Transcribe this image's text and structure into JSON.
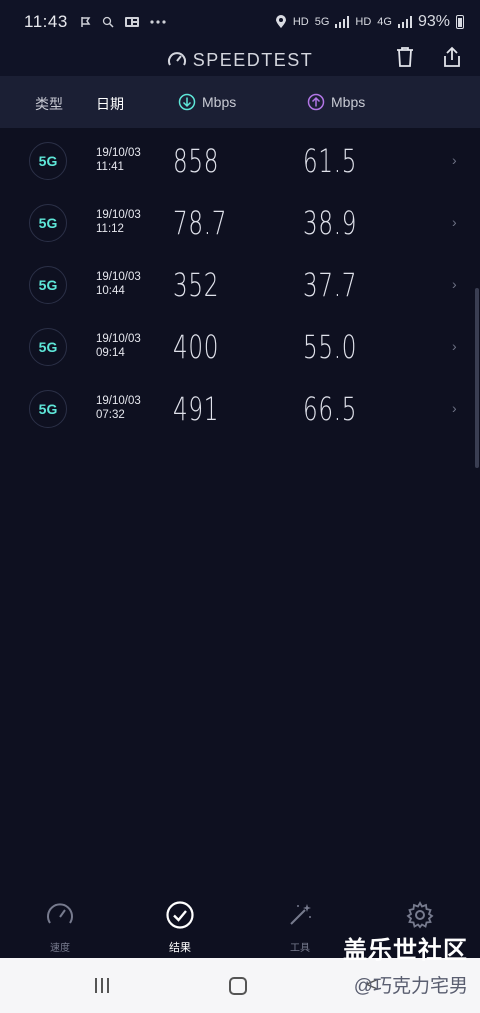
{
  "status_bar": {
    "time": "11:43",
    "left_icons": [
      "flag-icon",
      "search-icon",
      "news-icon",
      "more-icon"
    ],
    "hd1": "HD",
    "network": "5G",
    "hd2": "HD",
    "network2": "4G",
    "battery": "93%"
  },
  "app_bar": {
    "title": "SPEEDTEST"
  },
  "table_header": {
    "type": "类型",
    "date": "日期",
    "download_unit": "Mbps",
    "upload_unit": "Mbps"
  },
  "results": [
    {
      "type": "5G",
      "date": "19/10/03",
      "time": "11:41",
      "download": "858",
      "upload": "61.5"
    },
    {
      "type": "5G",
      "date": "19/10/03",
      "time": "11:12",
      "download": "78.7",
      "upload": "38.9"
    },
    {
      "type": "5G",
      "date": "19/10/03",
      "time": "10:44",
      "download": "352",
      "upload": "37.7"
    },
    {
      "type": "5G",
      "date": "19/10/03",
      "time": "09:14",
      "download": "400",
      "upload": "55.0"
    },
    {
      "type": "5G",
      "date": "19/10/03",
      "time": "07:32",
      "download": "491",
      "upload": "66.5"
    }
  ],
  "tabs": [
    {
      "label": "速度",
      "icon": "speedometer-icon"
    },
    {
      "label": "结果",
      "icon": "check-circle-icon",
      "active": true
    },
    {
      "label": "工具",
      "icon": "magic-wand-icon"
    },
    {
      "label": "",
      "icon": "gear-icon"
    }
  ],
  "watermark": {
    "line1": "盖乐世社区",
    "line2": "@巧克力宅男"
  },
  "colors": {
    "background": "#0e1020",
    "header_row": "#1b1f34",
    "accent_teal": "#5ee6d8",
    "accent_purple": "#b276e6"
  }
}
